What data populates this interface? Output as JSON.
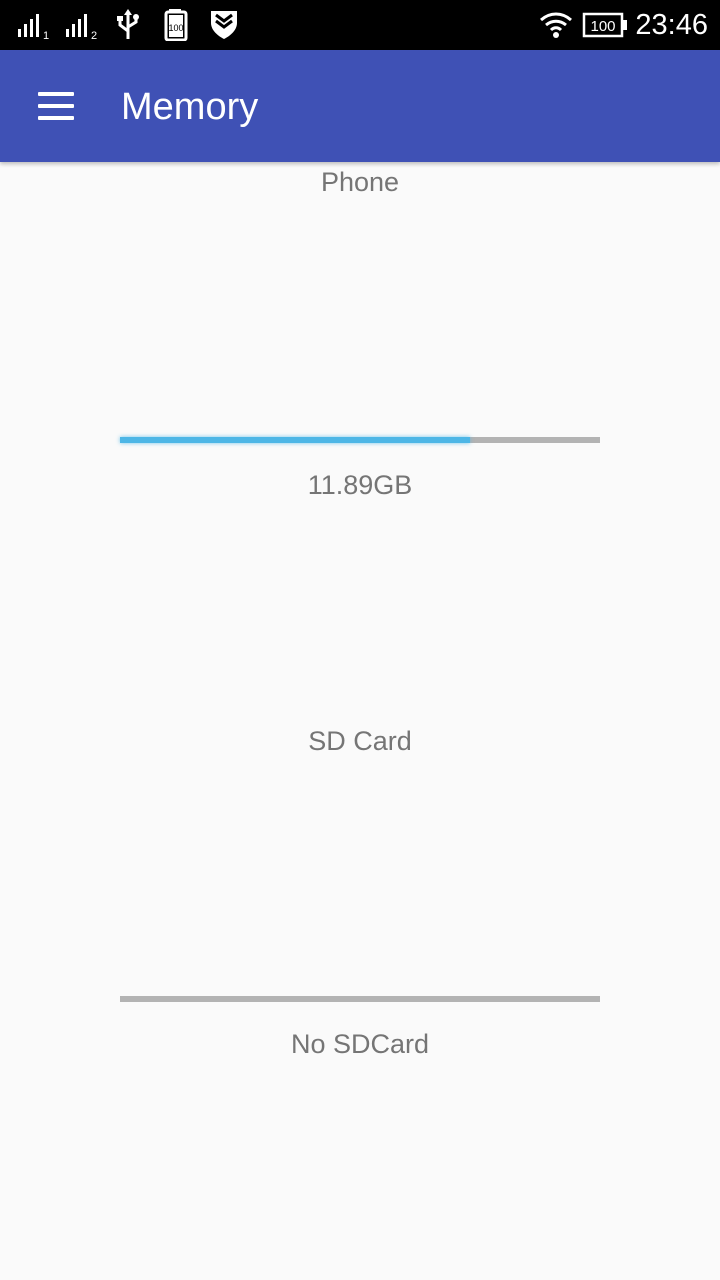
{
  "status_bar": {
    "time": "23:46",
    "battery_level": "100",
    "sim1_label": "1",
    "sim2_label": "2",
    "storage_badge": "100",
    "icons": [
      "signal-sim1-icon",
      "signal-sim2-icon",
      "usb-icon",
      "battery-saver-icon",
      "shield-icon",
      "wifi-icon",
      "battery-icon"
    ]
  },
  "app_bar": {
    "title": "Memory",
    "menu_icon": "hamburger-menu-icon",
    "color": "#3f51b5"
  },
  "storage": [
    {
      "name": "Phone",
      "value_text": "11.89GB",
      "used_fraction": 0.73,
      "fill_color": "#4db6e6"
    },
    {
      "name": "SD Card",
      "value_text": "No SDCard",
      "used_fraction": 0.0,
      "fill_color": "#4db6e6"
    }
  ]
}
